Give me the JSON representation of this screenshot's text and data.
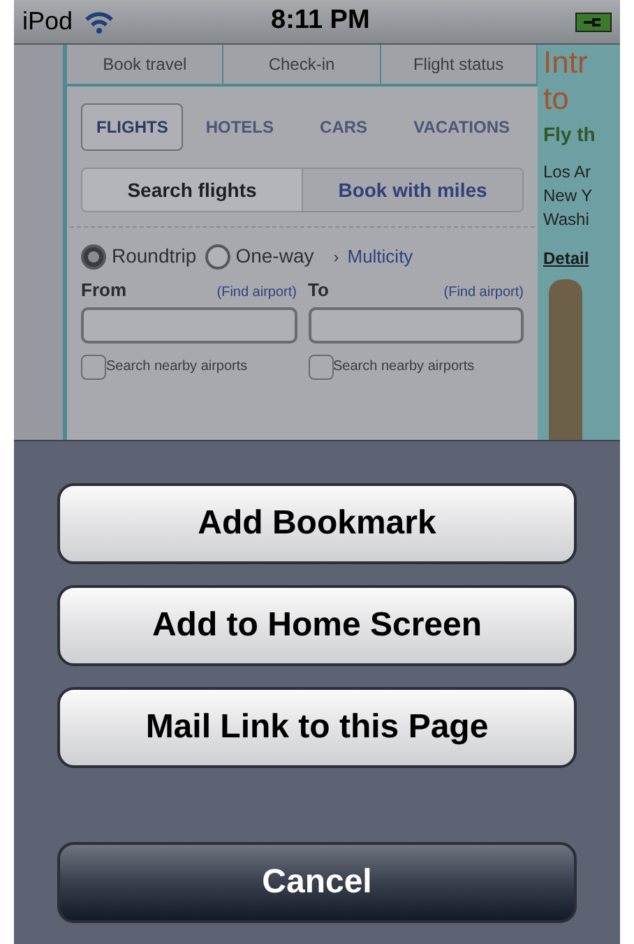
{
  "status_bar": {
    "carrier": "iPod",
    "time": "8:11 PM"
  },
  "page": {
    "top_tabs": [
      {
        "label": "Book travel"
      },
      {
        "label": "Check-in"
      },
      {
        "label": "Flight status"
      }
    ],
    "product_tabs": [
      {
        "label": "FLIGHTS",
        "selected": true
      },
      {
        "label": "HOTELS",
        "selected": false
      },
      {
        "label": "CARS",
        "selected": false
      },
      {
        "label": "VACATIONS",
        "selected": false
      }
    ],
    "search_modes": [
      {
        "label": "Search flights",
        "selected": true
      },
      {
        "label": "Book with miles",
        "selected": false
      }
    ],
    "trip_types": [
      {
        "label": "Roundtrip",
        "selected": true
      },
      {
        "label": "One-way",
        "selected": false
      }
    ],
    "multicity_link": {
      "arrow": "›",
      "label": "Multicity"
    },
    "airports": [
      {
        "label": "From",
        "link": "(Find airport)",
        "nearby": {
          "label": "Search nearby airports",
          "checked": false
        }
      },
      {
        "label": "To",
        "link": "(Find airport)",
        "nearby": {
          "label": "Search nearby airports",
          "checked": false
        }
      }
    ],
    "ad": {
      "headline": [
        "Intr",
        "to"
      ],
      "subhead": "Fly th",
      "lines": [
        "Los Ar",
        "New Y",
        "Washi"
      ],
      "link": "Detail"
    }
  },
  "action_sheet": {
    "buttons": [
      {
        "label": "Add Bookmark",
        "kind": "default"
      },
      {
        "label": "Add to Home Screen",
        "kind": "default"
      },
      {
        "label": "Mail Link to this Page",
        "kind": "default"
      },
      {
        "label": "Cancel",
        "kind": "cancel"
      }
    ]
  }
}
